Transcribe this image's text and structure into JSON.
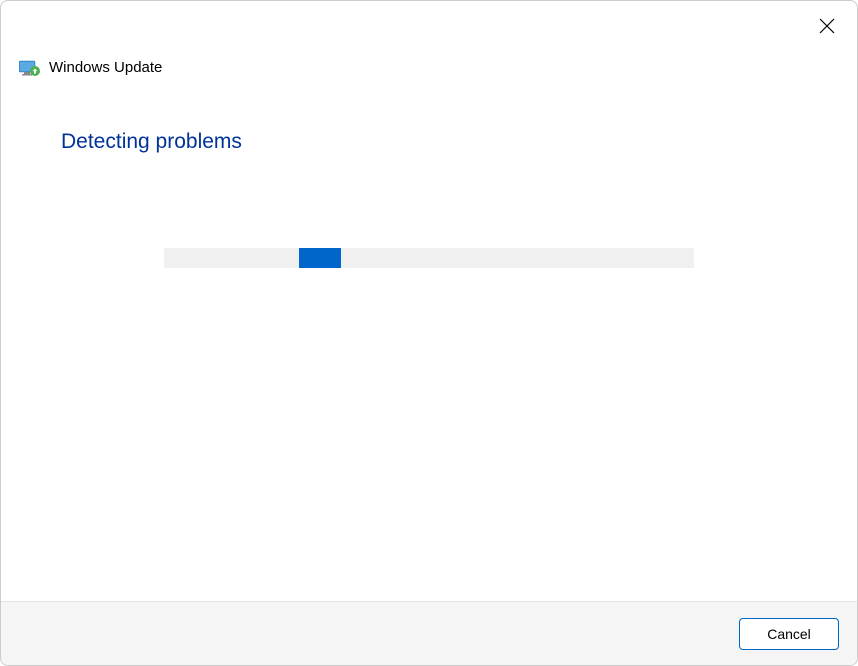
{
  "header": {
    "title": "Windows Update"
  },
  "main": {
    "heading": "Detecting problems"
  },
  "footer": {
    "cancel_label": "Cancel"
  }
}
